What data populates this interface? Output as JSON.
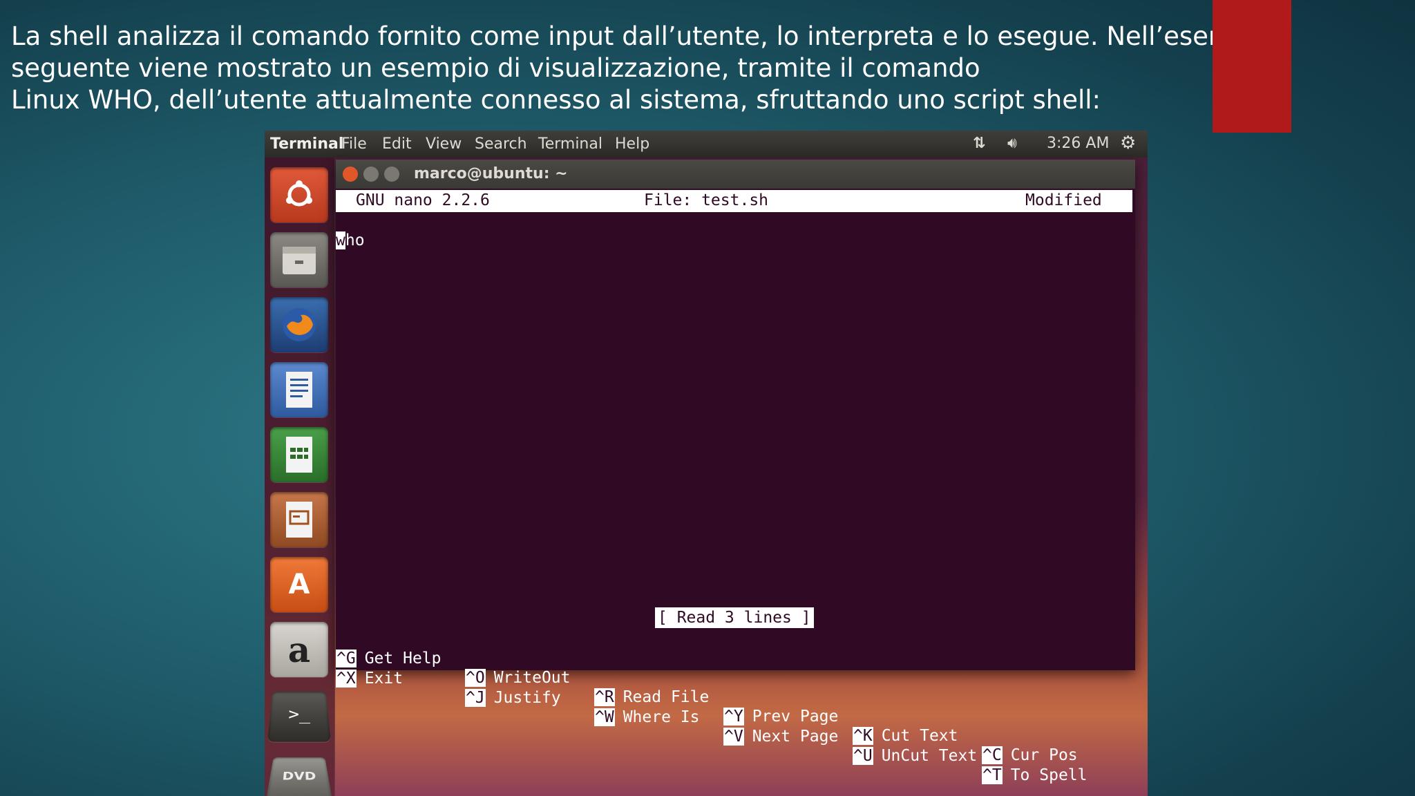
{
  "slide": {
    "line1": "La shell analizza il comando fornito come input dall’utente, lo interpreta e lo esegue. Nell’esempio",
    "line2": "seguente viene mostrato un esempio di visualizzazione, tramite il comando",
    "line3": "Linux WHO, dell’utente attualmente connesso al sistema, sfruttando uno script shell:",
    "accent_color": "#b11a1a"
  },
  "topbar": {
    "app_name": "Terminal",
    "menus": [
      "File",
      "Edit",
      "View",
      "Search",
      "Terminal",
      "Help"
    ],
    "network_icon": "network-updown-icon",
    "volume_icon": "volume-icon",
    "time": "3:26 AM",
    "settings_icon": "gear-icon"
  },
  "launcher": {
    "items": [
      "ubuntu-dash-icon",
      "files-icon",
      "firefox-icon",
      "writer-icon",
      "calc-icon",
      "impress-icon",
      "software-center-icon",
      "amazon-icon",
      "terminal-icon",
      "dvd-icon"
    ]
  },
  "window": {
    "title": "marco@ubuntu: ~",
    "close_color": "#e2572a"
  },
  "nano": {
    "version": "GNU nano 2.2.6",
    "file": "File: test.sh",
    "state": "Modified",
    "cursor_char": "w",
    "content_rest": "ho",
    "status": "[ Read 3 lines ]",
    "shortcuts_row1": [
      {
        "key": "^G",
        "label": "Get Help"
      },
      {
        "key": "^O",
        "label": "WriteOut"
      },
      {
        "key": "^R",
        "label": "Read File"
      },
      {
        "key": "^Y",
        "label": "Prev Page"
      },
      {
        "key": "^K",
        "label": "Cut Text"
      },
      {
        "key": "^C",
        "label": "Cur Pos"
      }
    ],
    "shortcuts_row2": [
      {
        "key": "^X",
        "label": "Exit"
      },
      {
        "key": "^J",
        "label": "Justify"
      },
      {
        "key": "^W",
        "label": "Where Is"
      },
      {
        "key": "^V",
        "label": "Next Page"
      },
      {
        "key": "^U",
        "label": "UnCut Text"
      },
      {
        "key": "^T",
        "label": "To Spell"
      }
    ]
  }
}
